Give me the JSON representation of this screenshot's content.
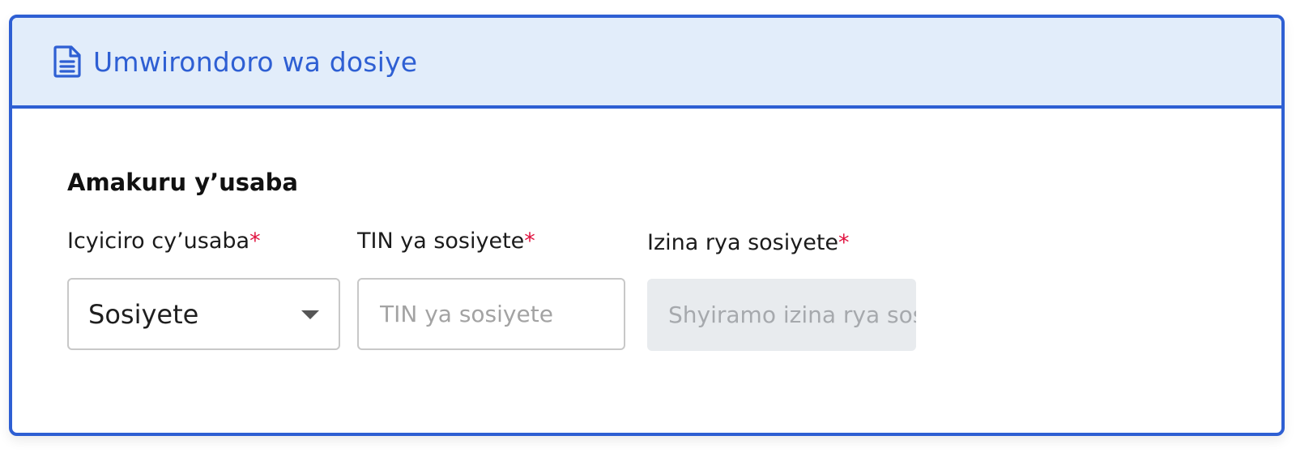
{
  "header": {
    "icon": "file-text-icon",
    "title": "Umwirondoro wa dosiye"
  },
  "section": {
    "title": "Amakuru y’usaba"
  },
  "fields": {
    "category": {
      "label": "Icyiciro cy’usaba",
      "required_mark": "*",
      "value": "Sosiyete",
      "icon": "chevron-down-icon"
    },
    "tin": {
      "label": "TIN ya sosiyete",
      "required_mark": "*",
      "value": "",
      "placeholder": "TIN ya sosiyete"
    },
    "company_name": {
      "label": "Izina rya sosiyete",
      "required_mark": "*",
      "value": "",
      "placeholder": "Shyiramo izina rya sosiyete",
      "disabled": true
    }
  },
  "colors": {
    "accent": "#2e5fd3",
    "header_bg": "#e2edfa",
    "required": "#e0123f",
    "disabled_bg": "#e8ebee"
  }
}
